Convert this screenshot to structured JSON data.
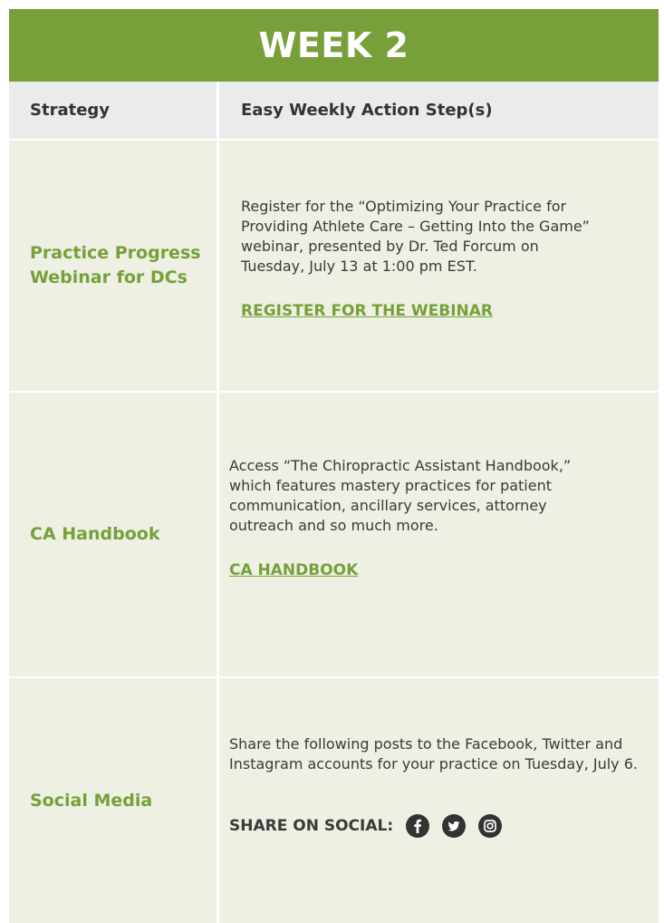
{
  "title": "WEEK 2",
  "headers": {
    "strategy": "Strategy",
    "action": "Easy Weekly Action Step(s)"
  },
  "rows": [
    {
      "strategy": "Practice Progress Webinar for DCs",
      "description": "Register for the “Optimizing Your Practice for Providing Athlete Care – Getting Into the Game” webinar, presented by Dr. Ted Forcum on Tuesday, July 13 at 1:00 pm EST.",
      "link": "REGISTER FOR THE WEBINAR"
    },
    {
      "strategy": "CA Handbook",
      "description": "Access “The Chiropractic Assistant Handbook,” which features mastery practices for patient communication, ancillary services, attorney outreach and so much more.",
      "link": "CA HANDBOOK"
    },
    {
      "strategy": "Social Media",
      "description": "Share the following posts to the Facebook, Twitter and Instagram accounts for your practice on Tuesday, July 6.",
      "share_label": "SHARE ON SOCIAL:",
      "icons": [
        "facebook-icon",
        "twitter-icon",
        "instagram-icon"
      ]
    }
  ],
  "colors": {
    "brand_green": "#77a03a",
    "row_bg": "#edf0e3",
    "header_bg": "#ebebeb",
    "icon_dark": "#333333"
  }
}
